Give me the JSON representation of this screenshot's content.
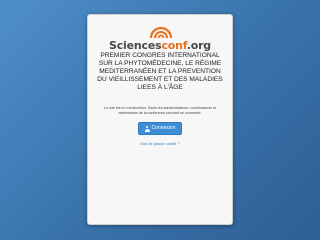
{
  "logo": {
    "part1": "Sciences",
    "part2": "conf",
    "part3": ".org"
  },
  "conference": {
    "title": "PREMIER CONGRES INTERNATIONAL SUR LA PHYTOMÉDECINE, LE RÉGIME MEDITERRANÉEN ET LA PREVENTION DU VIEILLISSEMENT ET DES MALADIES LIEES À L'ÂGE"
  },
  "notice": "Le site est en construction. Seuls les administrateurs, coordinateurs et webmasters de la conférence peuvent se connecter.",
  "login": {
    "button_label": "Connexion",
    "icon": "user-icon",
    "forgot_password": "Mot de passe oublié ?"
  },
  "colors": {
    "accent": "#3c8dd3",
    "logo_orange": "#e8711c",
    "background": "#3a74ad"
  }
}
